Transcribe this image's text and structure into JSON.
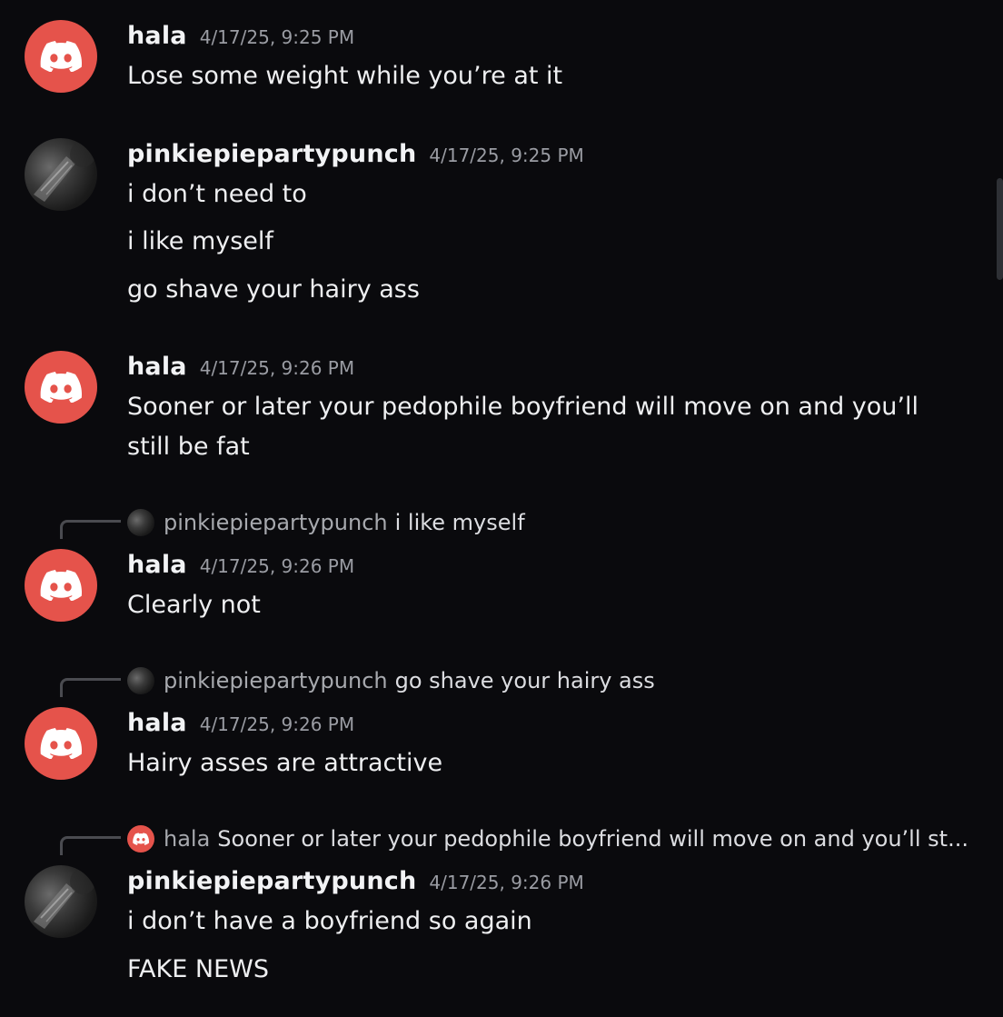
{
  "colors": {
    "background": "#0a0a0d",
    "discord_avatar": "#e5534b",
    "timestamp": "#9a9ca3"
  },
  "messages": [
    {
      "id": "m1",
      "author": "hala",
      "avatar": "discord-logo-icon",
      "timestamp": "4/17/25, 9:25 PM",
      "lines": [
        "Lose some weight while you’re at it"
      ]
    },
    {
      "id": "m2",
      "author": "pinkiepiepartypunch",
      "avatar": "user-photo-avatar",
      "timestamp": "4/17/25, 9:25 PM",
      "lines": [
        "i don’t need to",
        "i like myself",
        "go shave your hairy ass"
      ]
    },
    {
      "id": "m3",
      "author": "hala",
      "avatar": "discord-logo-icon",
      "timestamp": "4/17/25, 9:26 PM",
      "lines": [
        "Sooner or later your pedophile boyfriend will move on and you’ll",
        "still be fat"
      ]
    },
    {
      "id": "m4",
      "reply": {
        "author": "pinkiepiepartypunch",
        "text": "i like myself"
      },
      "author": "hala",
      "avatar": "discord-logo-icon",
      "timestamp": "4/17/25, 9:26 PM",
      "lines": [
        "Clearly not"
      ]
    },
    {
      "id": "m5",
      "reply": {
        "author": "pinkiepiepartypunch",
        "text": "go shave your hairy ass"
      },
      "author": "hala",
      "avatar": "discord-logo-icon",
      "timestamp": "4/17/25, 9:26 PM",
      "lines": [
        "Hairy asses are attractive"
      ]
    },
    {
      "id": "m6",
      "reply": {
        "author": "hala",
        "text": "Sooner or later your pedophile boyfriend will move on and you’ll st..."
      },
      "author": "pinkiepiepartypunch",
      "avatar": "user-photo-avatar",
      "timestamp": "4/17/25, 9:26 PM",
      "lines": [
        "i don’t have a boyfriend so again",
        "FAKE NEWS"
      ]
    }
  ]
}
